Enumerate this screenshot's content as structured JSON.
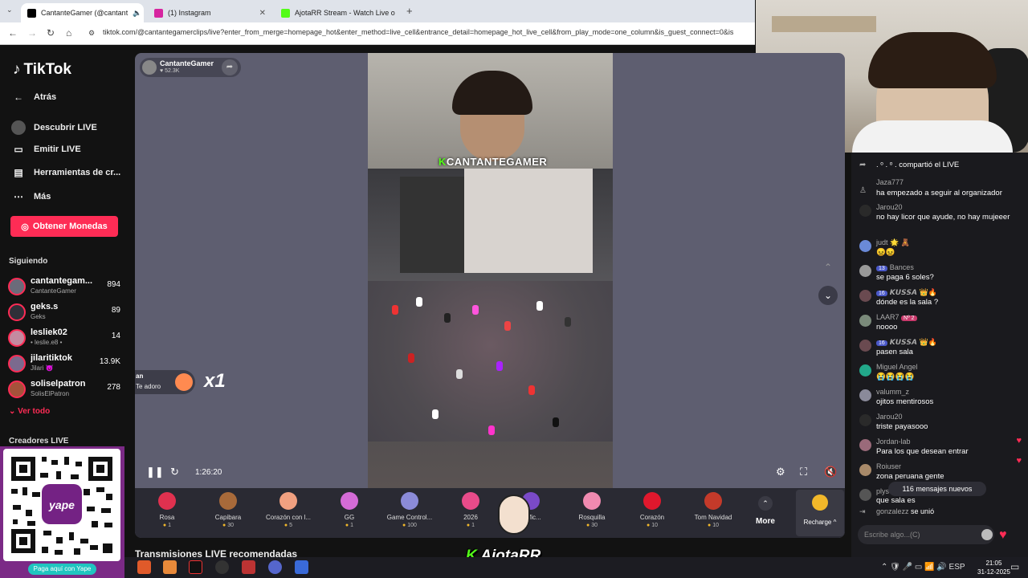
{
  "browser": {
    "tabs": [
      {
        "title": "CantanteGamer (@cantant",
        "favicon_color": "#000000",
        "active": true
      },
      {
        "title": "(1) Instagram",
        "favicon_color": "#d6249f",
        "active": false
      },
      {
        "title": "AjotaRR Stream - Watch Live o",
        "favicon_color": "#53fc18",
        "active": false
      }
    ],
    "url": "tiktok.com/@cantantegamerclips/live?enter_from_merge=homepage_hot&enter_method=live_cell&entrance_detail=homepage_hot_live_cell&from_play_mode=one_column&is_guest_connect=0&is"
  },
  "sidebar": {
    "logo": "TikTok",
    "nav": [
      {
        "label": "Atrás",
        "icon": "back-arrow-icon"
      },
      {
        "label": "Descubrir LIVE",
        "icon": "live-discover-icon"
      },
      {
        "label": "Emitir LIVE",
        "icon": "camera-icon"
      },
      {
        "label": "Herramientas de cr...",
        "icon": "tools-icon"
      },
      {
        "label": "Más",
        "icon": "more-dots-icon"
      }
    ],
    "coins_button": "Obtener Monedas",
    "following_title": "Siguiendo",
    "following": [
      {
        "name": "cantantegam...",
        "sub": "CantanteGamer",
        "count": "894",
        "color": "#6b6b7a"
      },
      {
        "name": "geks.s",
        "sub": "Geks",
        "count": "89",
        "color": "#2f2f38"
      },
      {
        "name": "lesliek02",
        "sub": "• leslie.e8 •",
        "count": "14",
        "color": "#c48aa0"
      },
      {
        "name": "jilaritiktok",
        "sub": "Jilari 😈",
        "count": "13.9K",
        "color": "#7b6a8e"
      },
      {
        "name": "soliselpatron",
        "sub": "SolisElPatron",
        "count": "278",
        "color": "#a5523a"
      }
    ],
    "see_all": "Ver todo",
    "creators_title": "Creadores LIVE"
  },
  "qr_overlay": {
    "brand": "yape",
    "caption": "Paga aquí con Yape"
  },
  "stage": {
    "host_name": "CantanteGamer",
    "host_likes": "♥ 52.3K",
    "cam_label": "CANTANTEGAMER",
    "gift_anim": {
      "user": "an",
      "message": "Te adoro",
      "multiplier": "x1"
    },
    "time": "1:26:20",
    "gifts": [
      {
        "name": "Rosa",
        "price": "1",
        "color": "#e0314f"
      },
      {
        "name": "Capibara",
        "price": "30",
        "color": "#a86a3a"
      },
      {
        "name": "Corazón con l...",
        "price": "5",
        "color": "#f0a080"
      },
      {
        "name": "GG",
        "price": "1",
        "color": "#d46bd6"
      },
      {
        "name": "Game Control...",
        "price": "100",
        "color": "#8b8bd8"
      },
      {
        "name": "2026",
        "price": "1",
        "color": "#e84b8a"
      },
      {
        "name": "Grific...",
        "price": "",
        "color": "#7a4ac8"
      },
      {
        "name": "Rosquilla",
        "price": "30",
        "color": "#f08ab0"
      },
      {
        "name": "Corazón",
        "price": "10",
        "color": "#e0182d"
      },
      {
        "name": "Tom Navidad",
        "price": "10",
        "color": "#c43a2a"
      }
    ],
    "more_label": "More",
    "recharge_label": "Recharge ^"
  },
  "recommended_title": "Transmisiones LIVE recomendadas",
  "streamer_logo": "AjotaRR",
  "chat": {
    "messages": [
      {
        "user": "",
        "text": ". ᵒ . ᵒ .  compartió el LIVE",
        "kind": "share",
        "color": "#444"
      },
      {
        "user": "Jaza777",
        "text": "ha empezado a seguir al organizador",
        "color": "#444"
      },
      {
        "user": "Jarou20",
        "text": "no hay licor que ayude, no hay mujeeer",
        "color": "#2a2a2a"
      },
      {
        "user": "judt 🌟 🧸",
        "text": "😖😖",
        "color": "#6a8ad8"
      },
      {
        "user": "Bances",
        "badge": "13",
        "text": "se paga 6 soles?",
        "color": "#999"
      },
      {
        "user": "𝙆𝙐𝙎𝙎𝘼 👑🔥",
        "badge": "16",
        "text": "dónde es la sala ?",
        "color": "#6a4a50"
      },
      {
        "user": "LAAR7",
        "badge_pink": "Nº 2",
        "text": "noooo",
        "color": "#7a8a7a"
      },
      {
        "user": "𝙆𝙐𝙎𝙎𝘼 👑🔥",
        "badge": "16",
        "text": "pasen sala",
        "color": "#6a4a50"
      },
      {
        "user": "Miguel Angel",
        "text": "😭😭😭😭",
        "color": "#22a88a"
      },
      {
        "user": "valumm_z",
        "text": "ojitos mentirosos",
        "color": "#8a8a9a"
      },
      {
        "user": "Jarou20",
        "text": "triste payasooo",
        "color": "#2a2a2a"
      },
      {
        "user": "Jordan-lab",
        "text": "Para los que desean entrar",
        "color": "#9a6a7a",
        "heart": true
      },
      {
        "user": "Roiuser",
        "text": "zona peruana gente",
        "color": "#a88a6a",
        "heart": true
      },
      {
        "user": "plys",
        "text": "que sala es",
        "color": "#555"
      },
      {
        "user": "gonzalezz",
        "text": "se unió",
        "kind": "join",
        "color": "#444"
      }
    ],
    "new_messages": "116 mensajes nuevos",
    "input_placeholder": "Escribe algo...(C)"
  },
  "taskbar": {
    "tray_text": "ESP",
    "time": "21:05",
    "date": "31-12-2025"
  }
}
